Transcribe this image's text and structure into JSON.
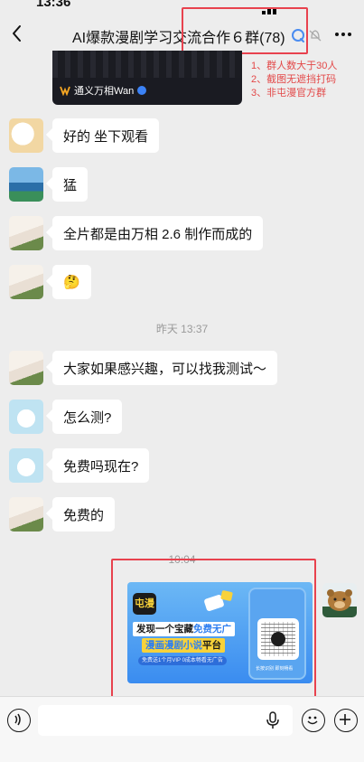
{
  "status_bar": {
    "time": "13:36"
  },
  "header": {
    "back_icon": "chevron-left-icon",
    "title": "AI爆款漫剧学习交流合作６群(78)",
    "more_icon": "more-dots-icon"
  },
  "notice": {
    "brand_name": "通义万相Wan",
    "rules": [
      "1、群人数大于30人",
      "2、截图无遮挡打码",
      "3、非屯漫官方群"
    ]
  },
  "messages": [
    {
      "avatar": "kitty-avatar",
      "text": "好的 坐下观看"
    },
    {
      "avatar": "seaside-avatar",
      "text": "猛"
    },
    {
      "avatar": "girl-avatar",
      "text": "全片都是由万相 2.6 制作而成的"
    },
    {
      "avatar": "girl-avatar",
      "text": "🤔"
    },
    {
      "avatar": "girl-avatar",
      "text": "大家如果感兴趣，可以找我测试～"
    },
    {
      "avatar": "dog-avatar",
      "text": "怎么测?"
    },
    {
      "avatar": "dog-avatar",
      "text": "免费吗现在?"
    },
    {
      "avatar": "girl-avatar",
      "text": "免费的"
    }
  ],
  "timestamps": {
    "t1": "昨天 13:37",
    "t2": "10:04"
  },
  "promo": {
    "logo": "屯漫",
    "line1_a": "发现一个宝藏",
    "line1_b": "免费无广",
    "line2_a": "漫画漫剧小说",
    "line2_b": "平台",
    "line3": "免费送1个月VIP 0成本畅看无广告",
    "qr_caption": "长按识别 即刻畅看"
  },
  "input_bar": {
    "voice_icon": "voice-icon",
    "mic_icon": "microphone-icon",
    "emoji_icon": "emoji-icon",
    "plus_icon": "plus-icon"
  },
  "colors": {
    "accent_red": "#e8424e",
    "promo_blue": "#3a8cf0",
    "promo_yellow": "#f8d23a"
  }
}
